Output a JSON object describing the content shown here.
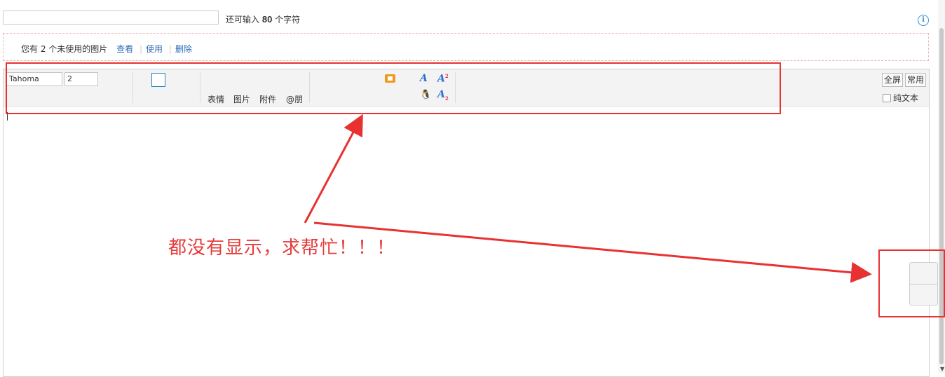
{
  "title_row": {
    "subject_value": "",
    "char_hint_prefix": "还可输入",
    "char_hint_count": "80",
    "char_hint_suffix": "个字符",
    "info_icon": "info-icon"
  },
  "image_notice": {
    "text": "您有 2 个未使用的图片",
    "view": "查看",
    "use": "使用",
    "delete": "删除"
  },
  "toolbar": {
    "font_family": "Tahoma",
    "font_size": "2",
    "items": [
      "表情",
      "图片",
      "附件",
      "@朋"
    ],
    "fullscreen": "全屏",
    "common": "常用",
    "plain_text": "纯文本"
  },
  "annotation": {
    "text": "都没有显示，求帮忙！！！",
    "color": "#e83232"
  }
}
